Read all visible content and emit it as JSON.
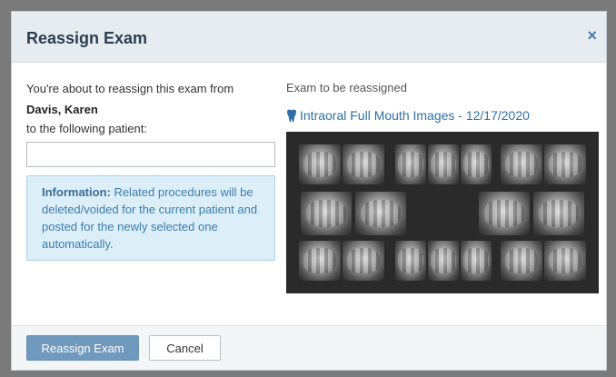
{
  "dialog": {
    "title": "Reassign Exam",
    "close_symbol": "×"
  },
  "left": {
    "intro_text": "You're about to reassign this exam from",
    "patient_name": "Davis, Karen",
    "to_label": "to the following patient:",
    "patient_input_value": "",
    "patient_input_placeholder": "",
    "info_label": "Information:",
    "info_text": " Related procedures will be deleted/voided for the current patient and posted for the newly selected one automatically."
  },
  "right": {
    "caption": "Exam to be reassigned",
    "exam_icon": "tooth-icon",
    "exam_link": "Intraoral Full Mouth Images - 12/17/2020",
    "xray_panel_color": "#2a2a2a"
  },
  "footer": {
    "primary_label": "Reassign Exam",
    "cancel_label": "Cancel"
  },
  "colors": {
    "accent": "#2f6fa3",
    "primary_button": "#6f99bd",
    "info_bg": "#dceef8",
    "header_bg": "#e6ecf0"
  }
}
